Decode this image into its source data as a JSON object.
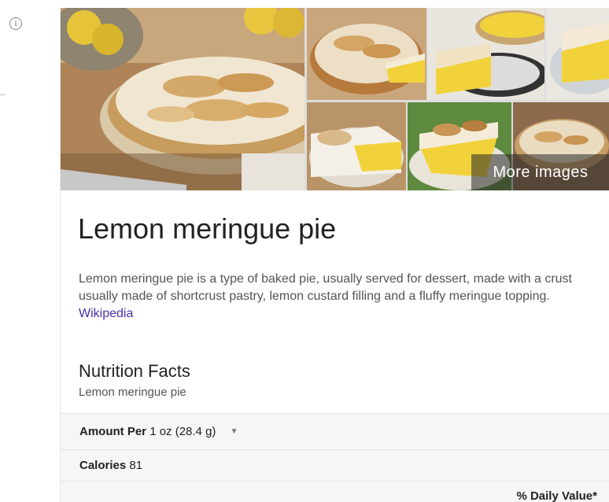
{
  "knowledge_panel": {
    "gallery": {
      "more_images_label": "More images"
    },
    "title": "Lemon meringue pie",
    "description": {
      "text": "Lemon meringue pie is a type of baked pie, usually served for dessert, made with a crust usually made of shortcrust pastry, lemon custard filling and a fluffy meringue topping.",
      "source_link": "Wikipedia"
    },
    "nutrition": {
      "heading": "Nutrition Facts",
      "subheading": "Lemon meringue pie",
      "amount_per_label": "Amount Per",
      "serving_size": "1 oz (28.4 g)",
      "calories_label": "Calories",
      "calories_value": "81",
      "daily_value_label": "% Daily Value*"
    }
  },
  "icons": {
    "info": "info-icon",
    "dropdown": "dropdown-arrow-icon"
  },
  "colors": {
    "link": "#4a2ea8",
    "row_background": "#f6f6f6",
    "meringue": "#e8d5b0",
    "lemon_filling": "#f2d23a"
  }
}
